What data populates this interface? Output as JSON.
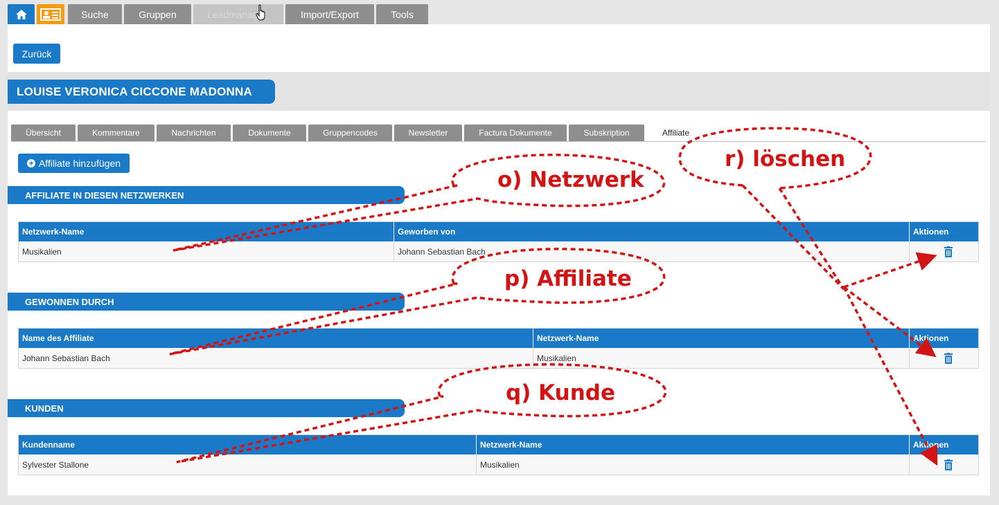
{
  "topnav": {
    "tabs": [
      "Suche",
      "Gruppen",
      "Leadmanager",
      "Import/Export",
      "Tools"
    ]
  },
  "back_label": "Zurück",
  "person_name": "LOUISE VERONICA CICCONE MADONNA",
  "subtabs": [
    "Übersicht",
    "Kommentare",
    "Nachrichten",
    "Dokumente",
    "Gruppencodes",
    "Newsletter",
    "Factura Dokumente",
    "Subskription",
    "Affiliate"
  ],
  "add_affiliate_label": "Affiliate hinzufügen",
  "sections": {
    "networks": {
      "title": "AFFILIATE IN DIESEN NETZWERKEN",
      "headers": [
        "Netzwerk-Name",
        "Geworben von",
        "Aktionen"
      ],
      "rows": [
        [
          "Musikalien",
          "Johann Sebastian Bach"
        ]
      ]
    },
    "won_by": {
      "title": "GEWONNEN DURCH",
      "headers": [
        "Name des Affiliate",
        "Netzwerk-Name",
        "Aktionen"
      ],
      "rows": [
        [
          "Johann Sebastian Bach",
          "Musikalien"
        ]
      ]
    },
    "customers": {
      "title": "KUNDEN",
      "headers": [
        "Kundenname",
        "Netzwerk-Name",
        "Aktionen"
      ],
      "rows": [
        [
          "Sylvester Stallone",
          "Musikalien"
        ]
      ]
    }
  },
  "annotations": {
    "network": "o) Netzwerk",
    "affiliate": "p) Affiliate",
    "customer": "q) Kunde",
    "delete": "r) löschen"
  },
  "colors": {
    "accent": "#1a7ac8",
    "annotation": "#d21414",
    "tab_gray": "#8e8e8e",
    "contact_tab": "#f39c12"
  },
  "icons": {
    "home_tab": "home-icon",
    "contact_tab": "contact-card-icon",
    "cursor": "hand-cursor-icon",
    "add": "plus-circle-icon",
    "delete": "trash-icon"
  }
}
